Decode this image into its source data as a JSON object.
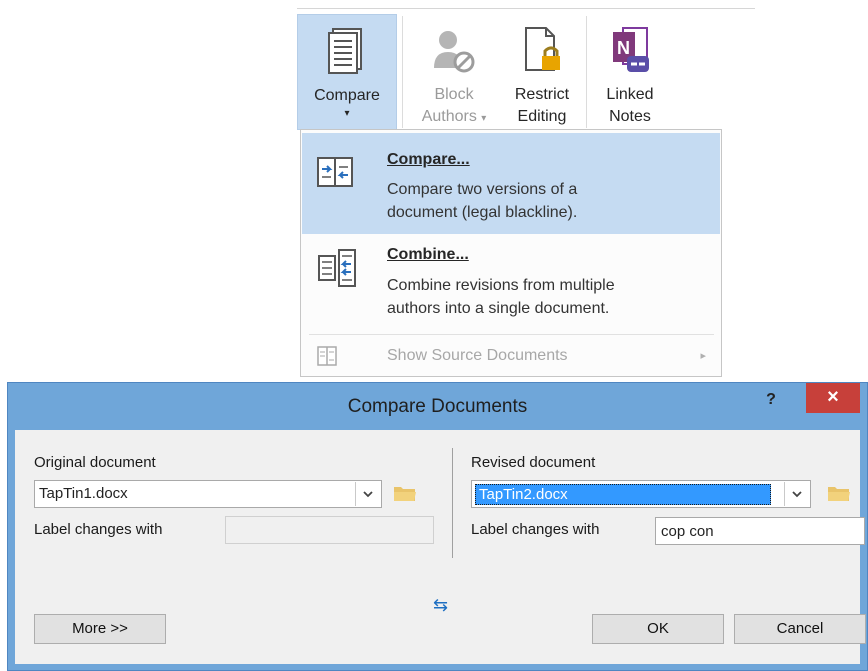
{
  "ribbon": {
    "compare": {
      "label": "Compare",
      "arrow": "▾",
      "icon": "compare-document-icon"
    },
    "block_authors": {
      "line1": "Block",
      "line2": "Authors",
      "arrow": "▾",
      "icon": "block-authors-icon"
    },
    "restrict_editing": {
      "line1": "Restrict",
      "line2": "Editing",
      "icon": "lock-document-icon"
    },
    "linked_notes": {
      "line1": "Linked",
      "line2": "Notes",
      "icon": "onenote-link-icon"
    }
  },
  "menu": {
    "compare": {
      "title": "Compare...",
      "desc1": "Compare two versions of a",
      "desc2": "document (legal blackline)."
    },
    "combine": {
      "title": "Combine...",
      "desc1": "Combine revisions from multiple",
      "desc2": "authors into a single document."
    },
    "show_source": {
      "label": "Show Source Documents",
      "arrow": "▸"
    }
  },
  "dialog": {
    "title": "Compare Documents",
    "help": "?",
    "close": "×",
    "original": {
      "label": "Original document",
      "value": "TapTin1.docx",
      "label_changes": "Label changes with",
      "label_value": ""
    },
    "revised": {
      "label": "Revised document",
      "value": "TapTin2.docx",
      "label_changes": "Label changes with",
      "label_value": "cop con"
    },
    "swap_icon": "⇆",
    "more_button": "More >>",
    "ok_button": "OK",
    "cancel_button": "Cancel"
  },
  "colors": {
    "highlight": "#c5dbf2",
    "dialog_frame": "#6fa6d9",
    "close_red": "#c7403a",
    "selection": "#3399ff"
  }
}
